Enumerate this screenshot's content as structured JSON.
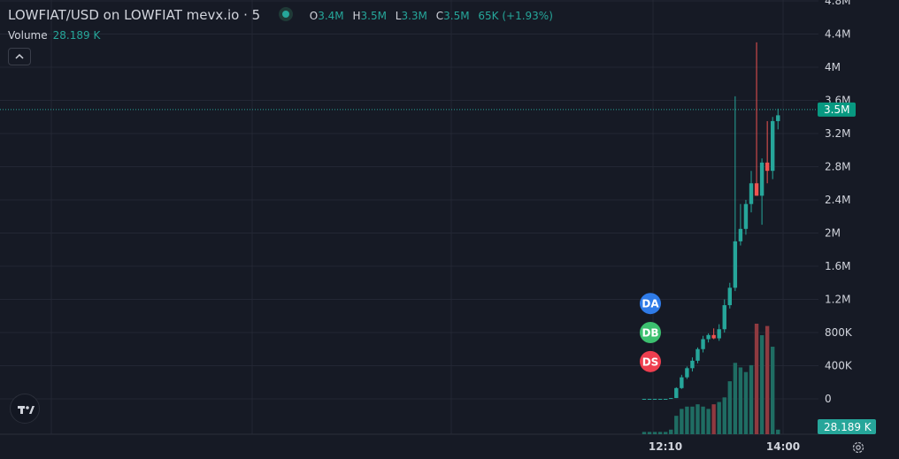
{
  "header": {
    "symbol_title": "LOWFIAT/USD on LOWFIAT mevx.io · 5",
    "o_label": "O",
    "o_value": "3.4M",
    "h_label": "H",
    "h_value": "3.5M",
    "l_label": "L",
    "l_value": "3.3M",
    "c_label": "C",
    "c_value": "3.5M",
    "change": "65K (+1.93%)",
    "volume_label": "Volume",
    "volume_value": "28.189 K",
    "collapse_glyph": "^"
  },
  "colors": {
    "background": "#161a25",
    "up": "#26a69a",
    "down": "#ef5350",
    "grid": "#232734",
    "axis_text": "#d1d4dc",
    "price_badge": "#089981",
    "volume_up": "#1f6d63",
    "volume_down": "#8f3a40"
  },
  "markers": [
    {
      "label": "DA",
      "color": "#2f7be8",
      "price": 1150000
    },
    {
      "label": "DB",
      "color": "#3cc06f",
      "price": 800000
    },
    {
      "label": "DS",
      "color": "#ef3e4f",
      "price": 450000
    }
  ],
  "chart_data": {
    "type": "candlestick",
    "y_axis": {
      "ticks": [
        {
          "value": 4800000,
          "label": "4.8M"
        },
        {
          "value": 4400000,
          "label": "4.4M"
        },
        {
          "value": 4000000,
          "label": "4M"
        },
        {
          "value": 3600000,
          "label": "3.6M"
        },
        {
          "value": 3200000,
          "label": "3.2M"
        },
        {
          "value": 2800000,
          "label": "2.8M"
        },
        {
          "value": 2400000,
          "label": "2.4M"
        },
        {
          "value": 2000000,
          "label": "2M"
        },
        {
          "value": 1600000,
          "label": "1.6M"
        },
        {
          "value": 1200000,
          "label": "1.2M"
        },
        {
          "value": 800000,
          "label": "800K"
        },
        {
          "value": 400000,
          "label": "400K"
        },
        {
          "value": 0,
          "label": "0"
        }
      ],
      "range": [
        0,
        4800000
      ]
    },
    "x_axis": {
      "ticks": [
        "12:10",
        "14:00"
      ]
    },
    "last_price": {
      "value": 3500000,
      "label": "3.5M"
    },
    "last_volume": {
      "label": "28.189 K"
    },
    "candles": [
      {
        "o": 0,
        "h": 0,
        "l": 0,
        "c": 0,
        "v": 5
      },
      {
        "o": 0,
        "h": 0,
        "l": 0,
        "c": 0,
        "v": 5
      },
      {
        "o": 0,
        "h": 0,
        "l": 0,
        "c": 0,
        "v": 5
      },
      {
        "o": 0,
        "h": 0,
        "l": 0,
        "c": 0,
        "v": 5
      },
      {
        "o": 0,
        "h": 0,
        "l": 0,
        "c": 0,
        "v": 5
      },
      {
        "o": 0,
        "h": 10000,
        "l": 0,
        "c": 10000,
        "v": 10
      },
      {
        "o": 10000,
        "h": 140000,
        "l": 10000,
        "c": 130000,
        "v": 40
      },
      {
        "o": 130000,
        "h": 290000,
        "l": 120000,
        "c": 260000,
        "v": 55
      },
      {
        "o": 260000,
        "h": 390000,
        "l": 240000,
        "c": 370000,
        "v": 60
      },
      {
        "o": 370000,
        "h": 500000,
        "l": 330000,
        "c": 460000,
        "v": 60
      },
      {
        "o": 460000,
        "h": 620000,
        "l": 430000,
        "c": 600000,
        "v": 65
      },
      {
        "o": 600000,
        "h": 760000,
        "l": 560000,
        "c": 720000,
        "v": 60
      },
      {
        "o": 720000,
        "h": 790000,
        "l": 680000,
        "c": 770000,
        "v": 55
      },
      {
        "o": 770000,
        "h": 850000,
        "l": 720000,
        "c": 730000,
        "v": 65
      },
      {
        "o": 730000,
        "h": 900000,
        "l": 700000,
        "c": 840000,
        "v": 70
      },
      {
        "o": 840000,
        "h": 1200000,
        "l": 800000,
        "c": 1130000,
        "v": 80
      },
      {
        "o": 1130000,
        "h": 1400000,
        "l": 1090000,
        "c": 1340000,
        "v": 115
      },
      {
        "o": 1340000,
        "h": 3650000,
        "l": 1300000,
        "c": 1900000,
        "v": 155
      },
      {
        "o": 1900000,
        "h": 2350000,
        "l": 1850000,
        "c": 2050000,
        "v": 145
      },
      {
        "o": 2050000,
        "h": 2400000,
        "l": 1980000,
        "c": 2350000,
        "v": 135
      },
      {
        "o": 2350000,
        "h": 2750000,
        "l": 2250000,
        "c": 2600000,
        "v": 150
      },
      {
        "o": 2600000,
        "h": 4300000,
        "l": 2450000,
        "c": 2450000,
        "v": 240
      },
      {
        "o": 2450000,
        "h": 2900000,
        "l": 2100000,
        "c": 2850000,
        "v": 215
      },
      {
        "o": 2850000,
        "h": 3350000,
        "l": 2600000,
        "c": 2750000,
        "v": 235
      },
      {
        "o": 2750000,
        "h": 3400000,
        "l": 2650000,
        "c": 3350000,
        "v": 190
      },
      {
        "o": 3350000,
        "h": 3500000,
        "l": 3250000,
        "c": 3420000,
        "v": 10
      }
    ]
  }
}
